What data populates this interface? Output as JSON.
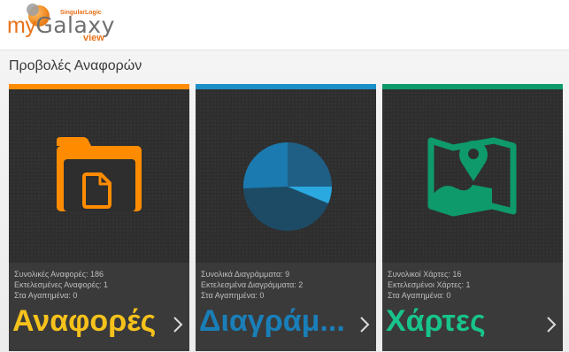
{
  "app": {
    "logo_prefix": "my",
    "logo_galaxy": "Galaxy",
    "logo_tagline": "SingularLogic",
    "logo_view": "view"
  },
  "page": {
    "title": "Προβολές Αναφορών"
  },
  "colors": {
    "reports_accent": "#ff8c00",
    "charts_accent": "#1b8fc8",
    "maps_accent": "#0e9a6a",
    "reports_title": "#f5c21b",
    "charts_title": "#1a7fb8",
    "maps_title": "#18c48c"
  },
  "tiles": [
    {
      "title": "Αναφορές",
      "icon": "folder-document-icon",
      "stats": [
        "Συνολικές Αναφορές: 186",
        "Εκτελεσμένες Αναφορές: 1",
        "Στα Αγαπημένα: 0"
      ]
    },
    {
      "title": "Διαγράμ...",
      "icon": "pie-chart-icon",
      "stats": [
        "Συνολικά Διαγράμματα: 9",
        "Εκτελεσμένα Διαγράμματα: 2",
        "Στα Αγαπημένα: 0"
      ]
    },
    {
      "title": "Χάρτες",
      "icon": "map-pin-icon",
      "stats": [
        "Συνολικοί Χάρτες: 16",
        "Εκτελεσμένοι Χάρτες: 1",
        "Στα Αγαπημένα: 0"
      ]
    }
  ]
}
